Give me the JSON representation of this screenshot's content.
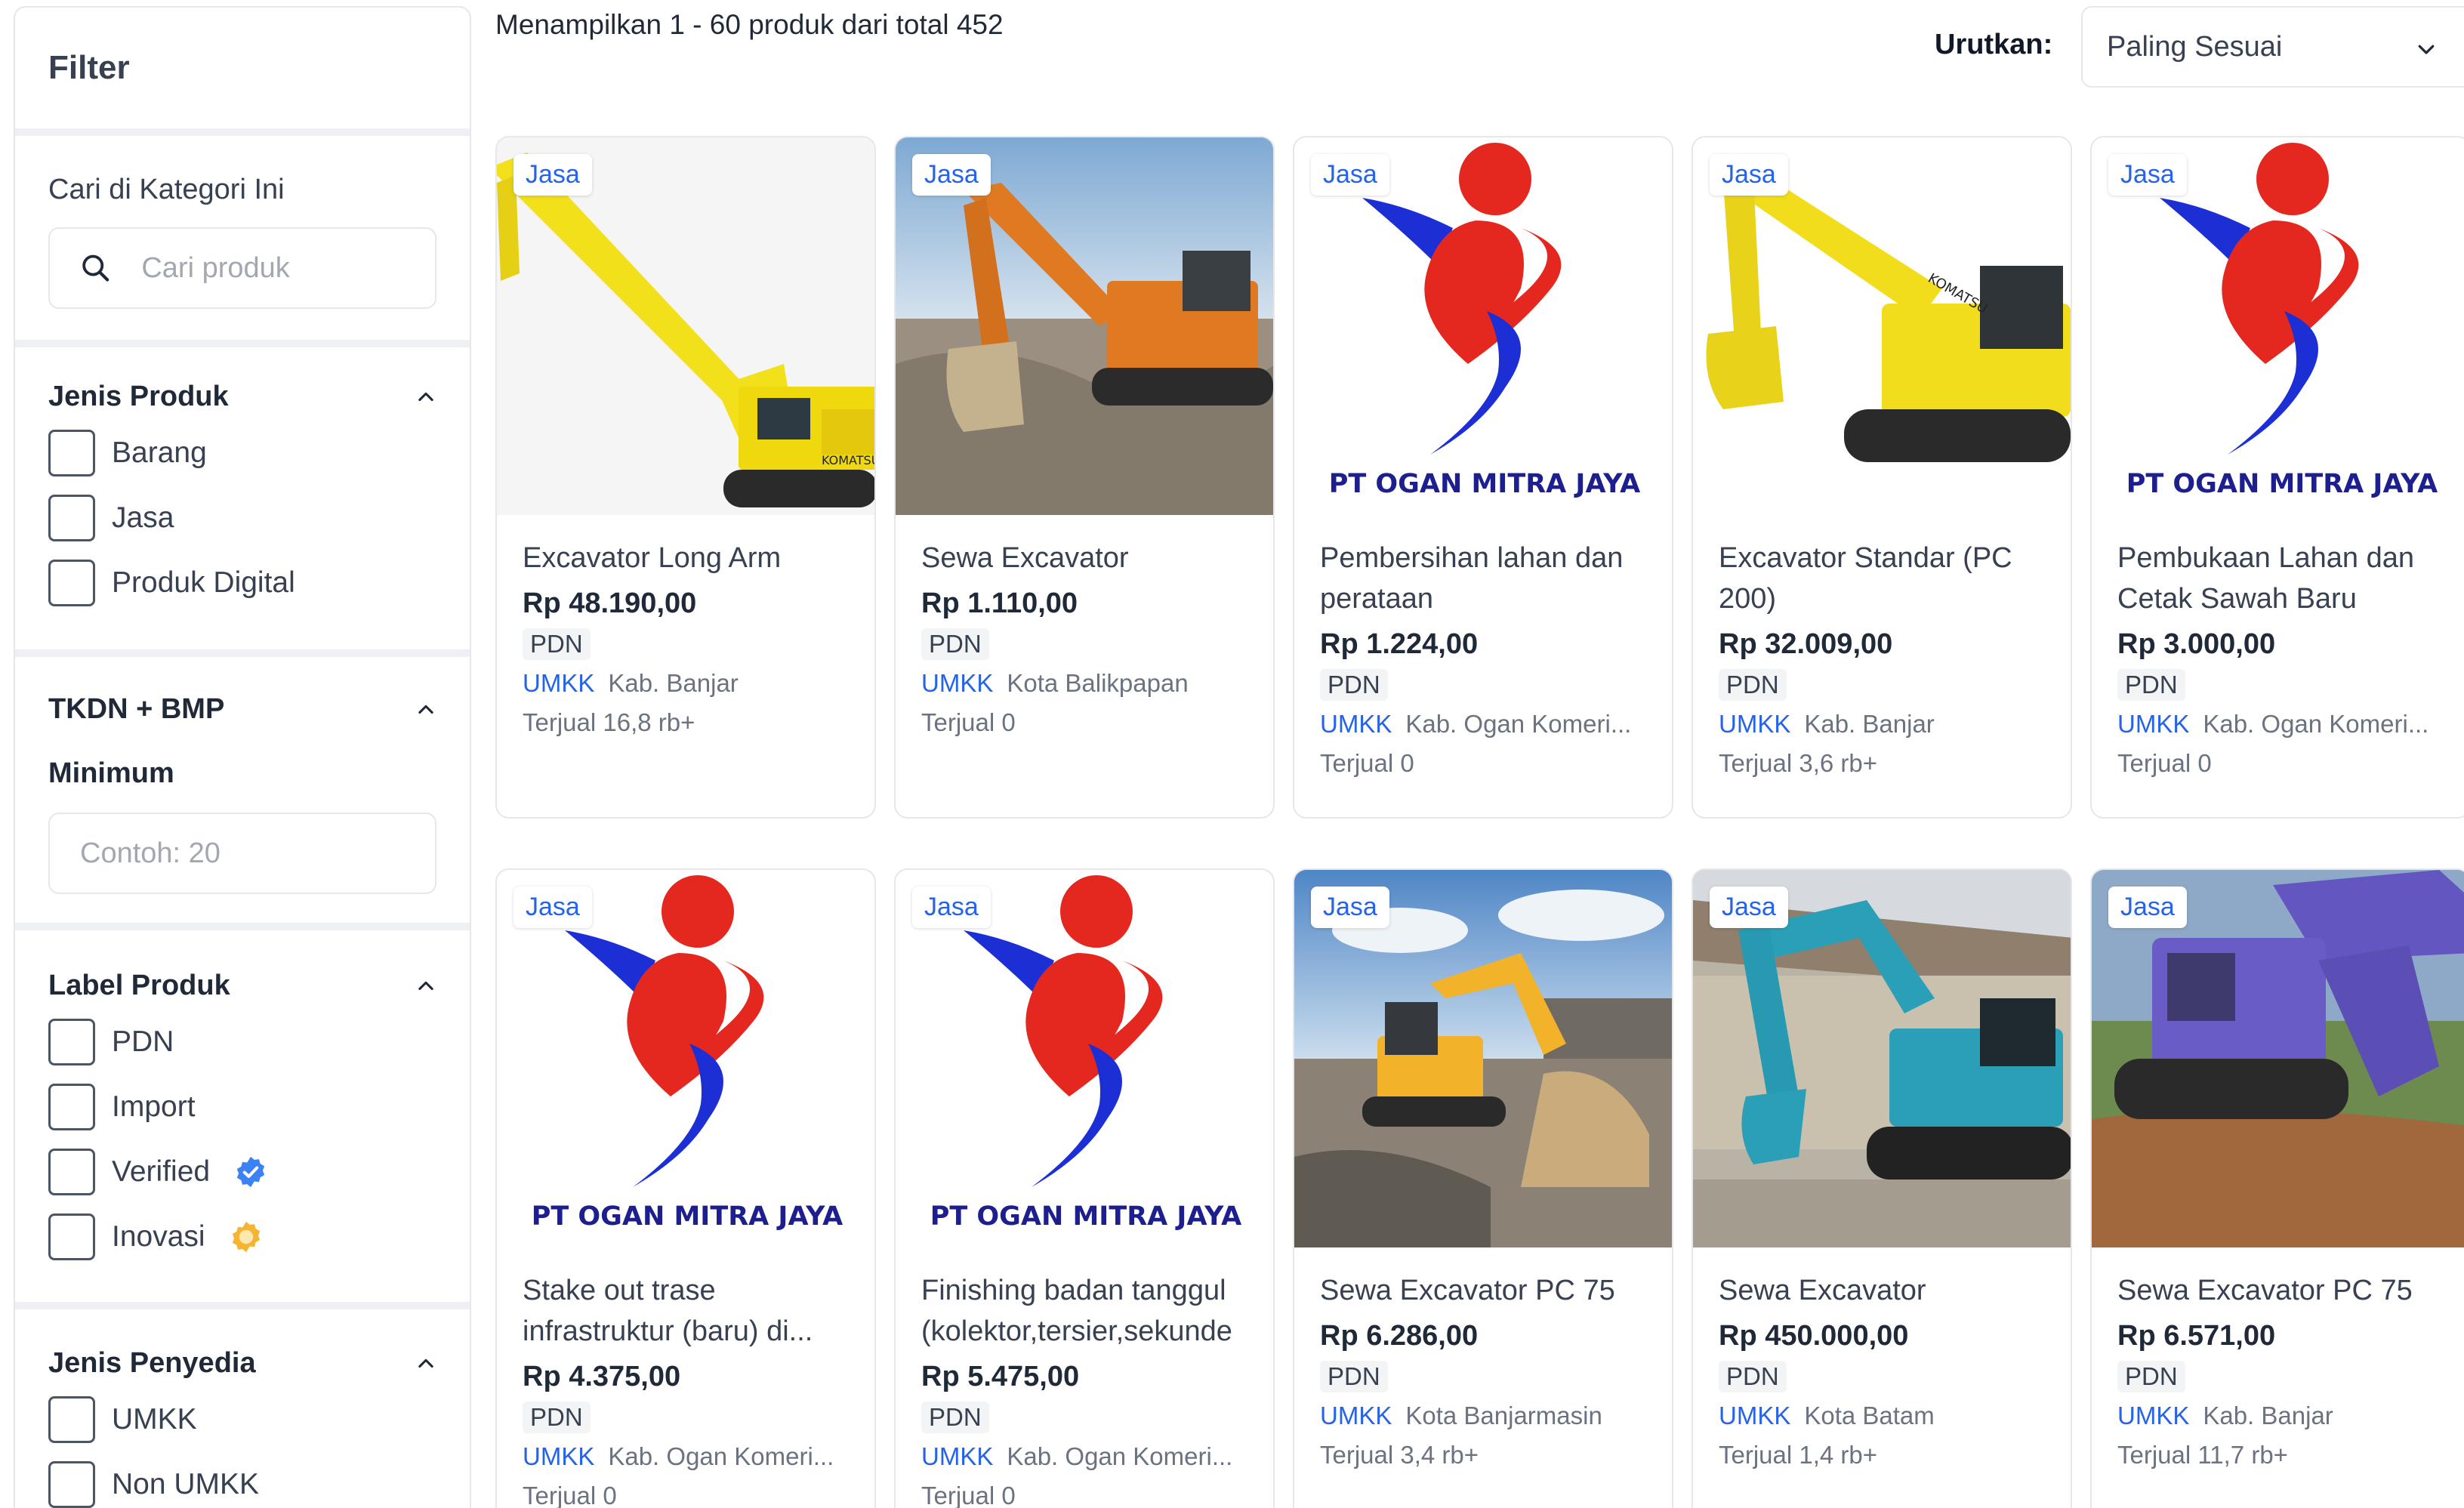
{
  "sidebar": {
    "title": "Filter",
    "search": {
      "title": "Cari di Kategori Ini",
      "placeholder": "Cari produk"
    },
    "jenis_produk": {
      "title": "Jenis Produk",
      "options": [
        "Barang",
        "Jasa",
        "Produk Digital"
      ]
    },
    "tkdn": {
      "title": "TKDN + BMP",
      "min_label": "Minimum",
      "placeholder": "Contoh: 20"
    },
    "label_produk": {
      "title": "Label Produk",
      "options": [
        "PDN",
        "Import",
        "Verified",
        "Inovasi"
      ]
    },
    "jenis_penyedia": {
      "title": "Jenis Penyedia",
      "options": [
        "UMKK",
        "Non UMKK"
      ]
    }
  },
  "topbar": {
    "results": "Menampilkan 1 - 60 produk dari total 452",
    "sort_label": "Urutkan:",
    "sort_value": "Paling Sesuai"
  },
  "logo_company": "PT OGAN MITRA JAYA",
  "products": [
    {
      "tag": "Jasa",
      "name": "Excavator Long Arm",
      "price": "Rp 48.190,00",
      "pdn": "PDN",
      "umkk": "UMKK",
      "location": "Kab. Banjar",
      "sold": "Terjual 16,8 rb+",
      "image": "excavator-long-arm"
    },
    {
      "tag": "Jasa",
      "name": "Sewa Excavator",
      "price": "Rp 1.110,00",
      "pdn": "PDN",
      "umkk": "UMKK",
      "location": "Kota Balikpapan",
      "sold": "Terjual 0",
      "image": "excavator-orange"
    },
    {
      "tag": "Jasa",
      "name": "Pembersihan lahan dan perataan",
      "price": "Rp 1.224,00",
      "pdn": "PDN",
      "umkk": "UMKK",
      "location": "Kab. Ogan Komeri...",
      "sold": "Terjual 0",
      "image": "company-logo"
    },
    {
      "tag": "Jasa",
      "name": "Excavator Standar (PC 200)",
      "price": "Rp 32.009,00",
      "pdn": "PDN",
      "umkk": "UMKK",
      "location": "Kab. Banjar",
      "sold": "Terjual 3,6 rb+",
      "image": "excavator-yellow"
    },
    {
      "tag": "Jasa",
      "name": "Pembukaan Lahan dan Cetak Sawah Baru",
      "price": "Rp 3.000,00",
      "pdn": "PDN",
      "umkk": "UMKK",
      "location": "Kab. Ogan Komeri...",
      "sold": "Terjual 0",
      "image": "company-logo"
    },
    {
      "tag": "Jasa",
      "name": "Stake out trase infrastruktur (baru) di...",
      "price": "Rp 4.375,00",
      "pdn": "PDN",
      "umkk": "UMKK",
      "location": "Kab. Ogan Komeri...",
      "sold": "Terjual 0",
      "image": "company-logo"
    },
    {
      "tag": "Jasa",
      "name": "Finishing badan tanggul (kolektor,tersier,sekunde",
      "price": "Rp 5.475,00",
      "pdn": "PDN",
      "umkk": "UMKK",
      "location": "Kab. Ogan Komeri...",
      "sold": "Terjual 0",
      "image": "company-logo"
    },
    {
      "tag": "Jasa",
      "name": "Sewa Excavator PC 75",
      "price": "Rp 6.286,00",
      "pdn": "PDN",
      "umkk": "UMKK",
      "location": "Kota Banjarmasin",
      "sold": "Terjual 3,4 rb+",
      "image": "excavator-site"
    },
    {
      "tag": "Jasa",
      "name": "Sewa Excavator",
      "price": "Rp 450.000,00",
      "pdn": "PDN",
      "umkk": "UMKK",
      "location": "Kota Batam",
      "sold": "Terjual 1,4 rb+",
      "image": "excavator-teal"
    },
    {
      "tag": "Jasa",
      "name": "Sewa Excavator PC 75",
      "price": "Rp 6.571,00",
      "pdn": "PDN",
      "umkk": "UMKK",
      "location": "Kab. Banjar",
      "sold": "Terjual 11,7 rb+",
      "image": "excavator-purple"
    }
  ]
}
